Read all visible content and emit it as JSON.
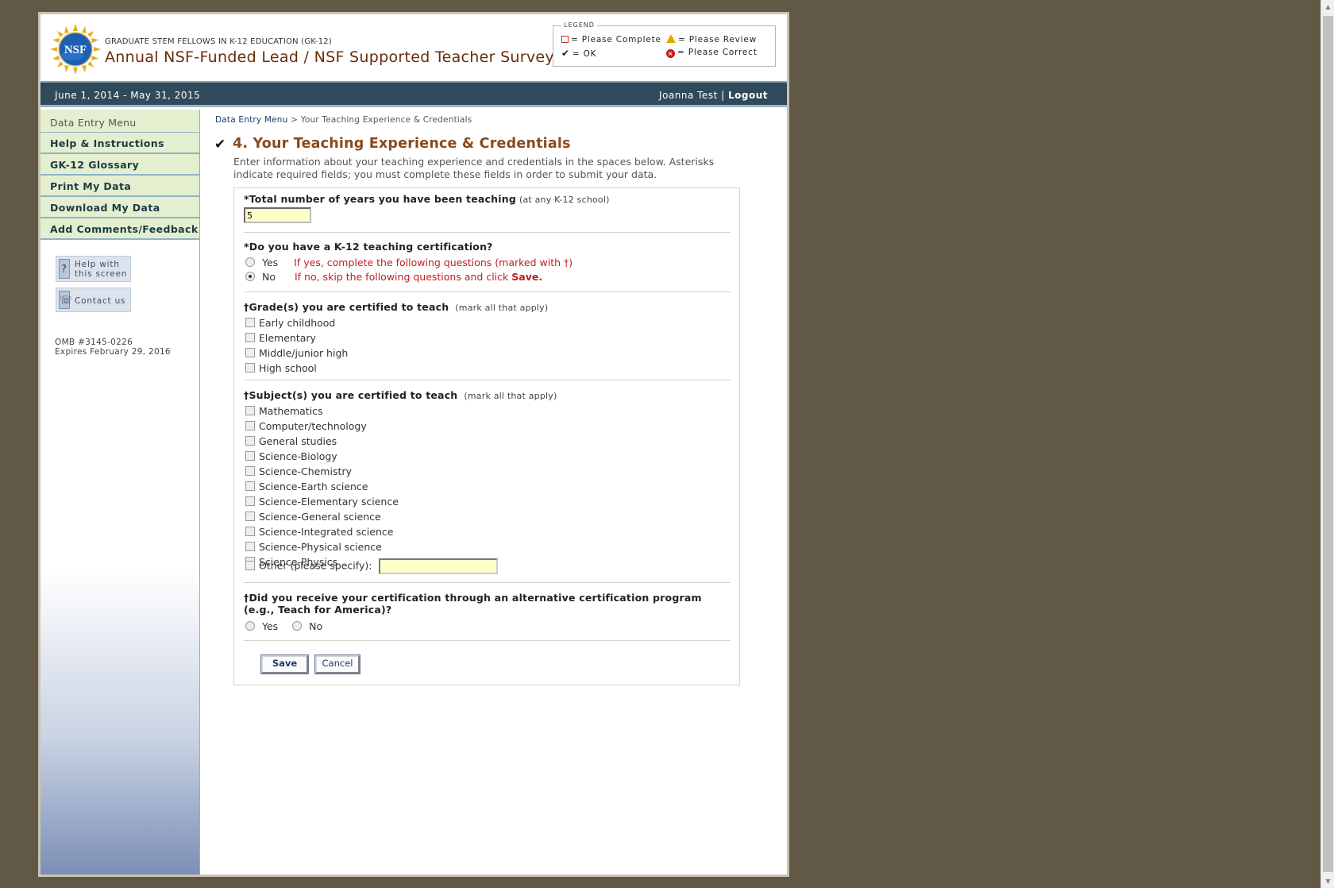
{
  "header": {
    "subtitle": "GRADUATE STEM FELLOWS IN K-12 EDUCATION (GK-12)",
    "title": "Annual NSF-Funded Lead / NSF Supported Teacher Survey",
    "logo_text": "NSF"
  },
  "legend": {
    "title": "LEGEND",
    "please_complete": "= Please Complete",
    "please_review": "= Please Review",
    "ok": "= OK",
    "please_correct": "= Please Correct"
  },
  "bar": {
    "dates": "June 1, 2014 - May 31, 2015",
    "user": "Joanna Test",
    "separator": "|",
    "logout": "Logout"
  },
  "sidebar": {
    "menu_title": "Data Entry Menu",
    "items": [
      {
        "label": "Help & Instructions"
      },
      {
        "label": "GK-12 Glossary"
      },
      {
        "label": "Print My Data"
      },
      {
        "label": "Download My Data"
      },
      {
        "label": "Add Comments/Feedback"
      }
    ],
    "help_btn_line1": "Help with",
    "help_btn_line2": "this screen",
    "contact_btn": "Contact us",
    "omb_line1": "OMB #3145-0226",
    "omb_line2": "Expires February 29, 2016"
  },
  "main": {
    "breadcrumb_link": "Data Entry Menu",
    "breadcrumb_sep": ">",
    "breadcrumb_current": "Your Teaching Experience & Credentials",
    "section_title": "4. Your Teaching Experience & Credentials",
    "intro": "Enter information about your teaching experience and credentials in the spaces below. Asterisks indicate required fields; you must complete these fields in order to submit your data."
  },
  "q1": {
    "label": "*Total number of years you have been teaching",
    "hint": "(at any K-12 school)",
    "value": "5"
  },
  "q2": {
    "label": "*Do you have a K-12 teaching certification?",
    "yes": "Yes",
    "yes_note": "If yes, complete the following questions (marked with †)",
    "no": "No",
    "no_note": "If no, skip the following questions and click",
    "no_note_bold": "Save.",
    "selected": "No"
  },
  "q3": {
    "label": "†Grade(s) you are certified to teach",
    "hint": "(mark all that apply)",
    "options": [
      "Early childhood",
      "Elementary",
      "Middle/junior high",
      "High school"
    ]
  },
  "q4": {
    "label": "†Subject(s) you are certified to teach",
    "hint": "(mark all that apply)",
    "options": [
      "Mathematics",
      "Computer/technology",
      "General studies",
      "Science-Biology",
      "Science-Chemistry",
      "Science-Earth science",
      "Science-Elementary science",
      "Science-General science",
      "Science-Integrated science",
      "Science-Physical science",
      "Science-Physics"
    ],
    "other_label": "Other (please specify):",
    "other_value": ""
  },
  "q5": {
    "label": "†Did you receive your certification through an alternative certification program (e.g., Teach for America)?",
    "yes": "Yes",
    "no": "No"
  },
  "buttons": {
    "save": "Save",
    "cancel": "Cancel"
  },
  "colors": {
    "background": "#615946",
    "nav_bar": "#30495b",
    "title": "#8a4a1c",
    "required_note": "#c21d1d",
    "input_bg": "#ffffc8"
  }
}
